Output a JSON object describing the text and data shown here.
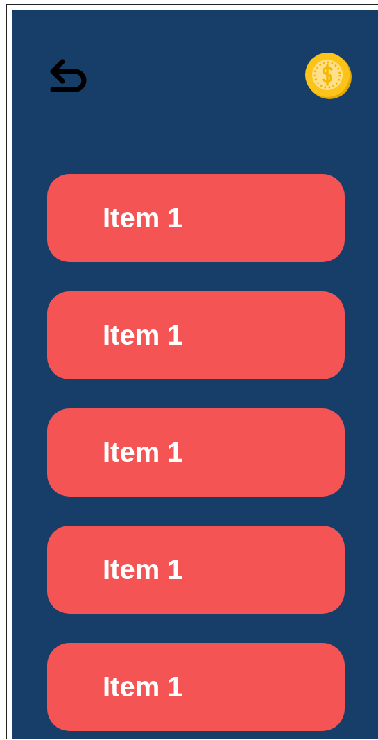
{
  "items": [
    {
      "label": "Item 1"
    },
    {
      "label": "Item 1"
    },
    {
      "label": "Item 1"
    },
    {
      "label": "Item 1"
    },
    {
      "label": "Item 1"
    }
  ]
}
